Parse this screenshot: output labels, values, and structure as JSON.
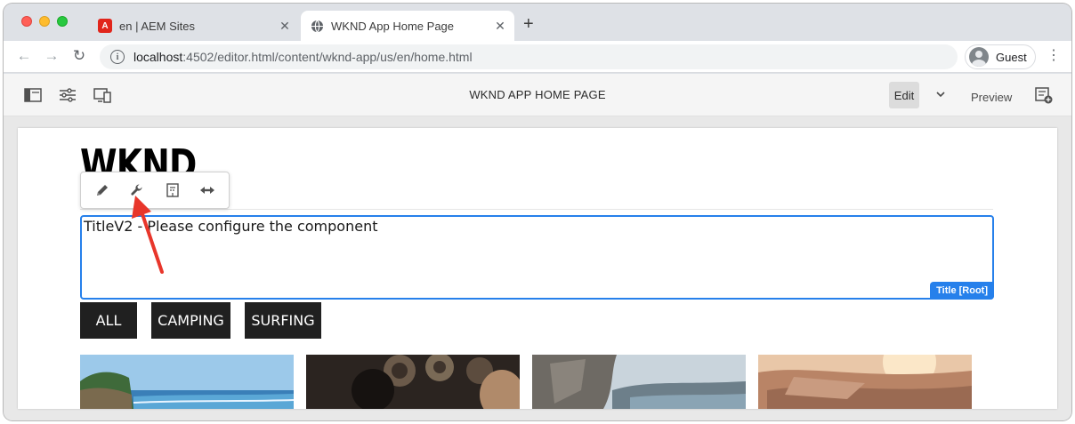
{
  "browser": {
    "tabs": [
      {
        "title": "en | AEM Sites",
        "favicon": "adobe-icon",
        "active": false
      },
      {
        "title": "WKND App Home Page",
        "favicon": "globe-icon",
        "active": true
      }
    ],
    "new_tab_label": "+",
    "url_host": "localhost",
    "url_rest": ":4502/editor.html/content/wknd-app/us/en/home.html",
    "profile_label": "Guest"
  },
  "aem": {
    "page_title": "WKND APP HOME PAGE",
    "mode_edit": "Edit",
    "mode_preview": "Preview",
    "colors": {
      "selection": "#2680eb",
      "annotation_arrow": "#e8362b"
    }
  },
  "page": {
    "logo": "WKND",
    "title_component_text": "TitleV2 - Please configure the component",
    "component_badge": "Title [Root]",
    "filters": [
      "ALL",
      "CAMPING",
      "SURFING"
    ]
  }
}
